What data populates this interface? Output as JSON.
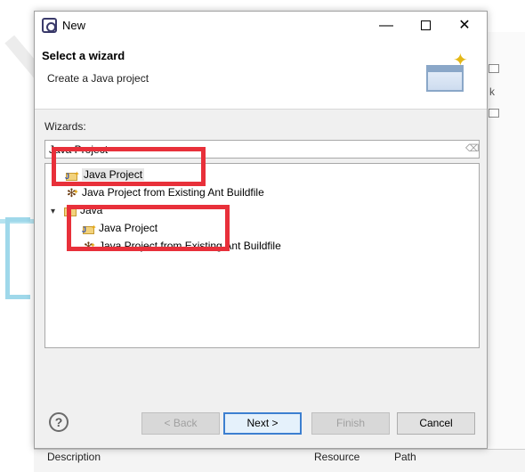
{
  "dialog": {
    "title": "New",
    "header": {
      "title": "Select a wizard",
      "subtitle": "Create a Java project"
    },
    "wizards_label": "Wizards:",
    "filter": {
      "value": "Java Project",
      "placeholder": ""
    },
    "tree": {
      "top_items": [
        {
          "label": "Java Project",
          "icon": "java-project-icon",
          "selected": true
        },
        {
          "label": "Java Project from Existing Ant Buildfile",
          "icon": "ant-buildfile-icon"
        }
      ],
      "folder": {
        "label": "Java",
        "expanded": true,
        "children": [
          {
            "label": "Java Project",
            "icon": "java-project-icon"
          },
          {
            "label": "Java Project from Existing Ant Buildfile",
            "icon": "ant-buildfile-icon"
          }
        ]
      }
    },
    "buttons": {
      "back": "< Back",
      "next": "Next >",
      "finish": "Finish",
      "cancel": "Cancel"
    },
    "help_glyph": "?"
  },
  "background": {
    "columns": [
      "Description",
      "Resource",
      "Path"
    ],
    "right_edge_text": "k"
  },
  "colors": {
    "highlight": "#e8303a",
    "dialog_bg": "#f0f0f0",
    "default_button_border": "#3c7fd0"
  }
}
